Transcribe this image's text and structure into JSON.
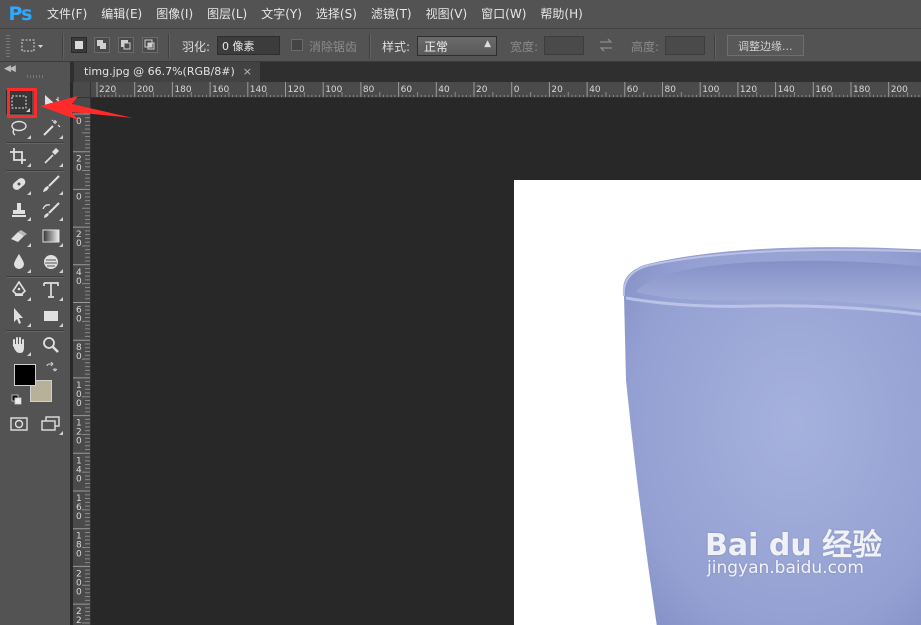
{
  "app": {
    "logo": "Ps"
  },
  "menu": [
    {
      "label": "文件(F)"
    },
    {
      "label": "编辑(E)"
    },
    {
      "label": "图像(I)"
    },
    {
      "label": "图层(L)"
    },
    {
      "label": "文字(Y)"
    },
    {
      "label": "选择(S)"
    },
    {
      "label": "滤镜(T)"
    },
    {
      "label": "视图(V)"
    },
    {
      "label": "窗口(W)"
    },
    {
      "label": "帮助(H)"
    }
  ],
  "options": {
    "feather_label": "羽化:",
    "feather_value": "0 像素",
    "antialias_label": "消除锯齿",
    "style_label": "样式:",
    "style_value": "正常",
    "width_label": "宽度:",
    "height_label": "高度:",
    "refine_edge_button": "调整边缘..."
  },
  "document": {
    "tab_title": "timg.jpg @ 66.7%(RGB/8#)",
    "close_glyph": "×"
  },
  "ruler": {
    "horizontal_labels": [
      "220",
      "200",
      "180",
      "160",
      "140",
      "120",
      "100",
      "80",
      "60",
      "40",
      "20",
      "0",
      "20",
      "40",
      "60",
      "80",
      "100",
      "120",
      "140",
      "160",
      "180",
      "200"
    ],
    "vertical_labels": [
      "0",
      "2\n0",
      "0",
      "2\n0",
      "4\n0",
      "6\n0",
      "8\n0",
      "1\n0\n0",
      "1\n2\n0",
      "1\n4\n0",
      "1\n6\n0",
      "1\n8\n0",
      "2\n0\n0",
      "2\n2\n0"
    ]
  },
  "colors": {
    "foreground": "#000000",
    "background": "#b8b19a",
    "highlight": "#ff2a2a",
    "cup": "#9aa6d6"
  },
  "watermark": {
    "brand": "Bai du 经验",
    "url": "jingyan.baidu.com"
  },
  "tools": [
    {
      "name": "rectangular-marquee-icon",
      "selected": true
    },
    {
      "name": "move-icon"
    },
    {
      "name": "lasso-icon"
    },
    {
      "name": "magic-wand-icon"
    },
    {
      "name": "crop-icon"
    },
    {
      "name": "eyedropper-icon"
    },
    {
      "name": "spot-healing-icon"
    },
    {
      "name": "brush-icon"
    },
    {
      "name": "clone-stamp-icon"
    },
    {
      "name": "history-brush-icon"
    },
    {
      "name": "eraser-icon"
    },
    {
      "name": "gradient-icon"
    },
    {
      "name": "blur-icon"
    },
    {
      "name": "dodge-icon"
    },
    {
      "name": "pen-icon"
    },
    {
      "name": "type-icon"
    },
    {
      "name": "path-selection-icon"
    },
    {
      "name": "rectangle-shape-icon"
    },
    {
      "name": "hand-icon"
    },
    {
      "name": "zoom-icon"
    },
    {
      "name": "quick-mask-icon"
    },
    {
      "name": "screen-mode-icon"
    }
  ]
}
